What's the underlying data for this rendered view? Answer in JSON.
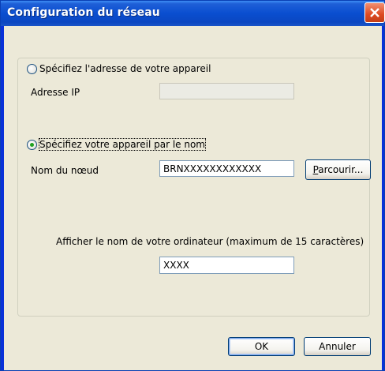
{
  "window": {
    "title": "Configuration du réseau",
    "close_icon": "close-icon"
  },
  "option_address": {
    "label": "Spécifiez l'adresse de votre appareil",
    "selected": false,
    "ip_label": "Adresse IP",
    "ip_value": ""
  },
  "option_name": {
    "label": "Spécifiez votre appareil par le nom",
    "selected": true,
    "node_label": "Nom du nœud",
    "node_value": "BRNXXXXXXXXXXXX",
    "browse_accel": "P",
    "browse_rest": "arcourir..."
  },
  "computer_name": {
    "label": "Afficher le nom de votre ordinateur (maximum de 15 caractères)",
    "value": "XXXX"
  },
  "buttons": {
    "ok": "OK",
    "cancel": "Annuler"
  },
  "colors": {
    "titlebar": "#0a4ed0",
    "close": "#dd4a21",
    "radio_dot": "#21a121",
    "dialog_bg": "#ece9d8"
  }
}
